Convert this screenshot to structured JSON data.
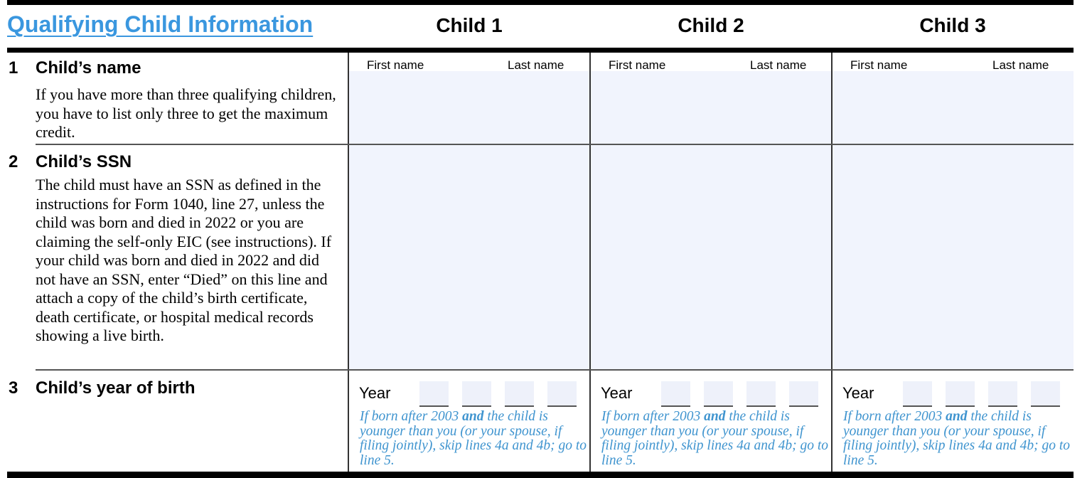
{
  "form": {
    "section_title": "Qualifying Child Information",
    "columns": [
      "Child 1",
      "Child 2",
      "Child 3"
    ],
    "lines": [
      {
        "number": "1",
        "title": "Child’s name",
        "description": "If you have more than three qualifying children, you have to list only three to get the maximum credit."
      },
      {
        "number": "2",
        "title": "Child’s SSN",
        "description": "The child must have an SSN as defined in the instructions for Form 1040, line 27, unless the child was born and died in 2022 or you are claiming the self-only EIC (see instructions). If your child was born and died in 2022 and did not have an SSN, enter “Died” on this line and attach a copy of the child’s birth certificate, death certificate, or hospital medical records showing a live birth."
      },
      {
        "number": "3",
        "title": "Child’s year of birth",
        "description": ""
      }
    ],
    "name_fields": {
      "first_label": "First name",
      "last_label": "Last name"
    },
    "year_field": {
      "label": "Year",
      "note_part1": "If born after 2003 ",
      "note_bold": "and",
      "note_part2": " the child is younger than you (or your spouse, if filing jointly), skip lines 4a and 4b; go to line 5."
    },
    "children": [
      {
        "first_name": "",
        "last_name": "",
        "ssn": "",
        "year_digits": [
          "",
          "",
          "",
          ""
        ]
      },
      {
        "first_name": "",
        "last_name": "",
        "ssn": "",
        "year_digits": [
          "",
          "",
          "",
          ""
        ]
      },
      {
        "first_name": "",
        "last_name": "",
        "ssn": "",
        "year_digits": [
          "",
          "",
          "",
          ""
        ]
      }
    ],
    "colors": {
      "title_blue": "#3a97df",
      "note_blue": "#3f94cf",
      "field_fill": "#f1f4fd"
    }
  }
}
